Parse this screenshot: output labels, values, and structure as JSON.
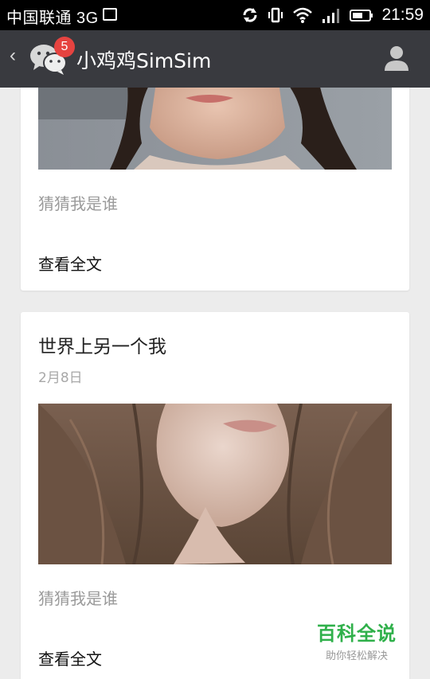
{
  "status_bar": {
    "carrier": "中国联通 3G",
    "time": "21:59"
  },
  "app_bar": {
    "title": "小鸡鸡SimSim",
    "badge_count": "5",
    "back_glyph": "‹"
  },
  "posts": [
    {
      "description": "猜猜我是谁",
      "more_label": "查看全文"
    },
    {
      "title": "世界上另一个我",
      "date": "2月8日",
      "description": "猜猜我是谁",
      "more_label": "查看全文"
    }
  ],
  "watermark": {
    "brand": "百科全说",
    "tagline": "助你轻松解决"
  },
  "colors": {
    "app_bar": "#393a3f",
    "badge": "#e64340",
    "background": "#ececec",
    "watermark_green": "#2fb04a"
  }
}
